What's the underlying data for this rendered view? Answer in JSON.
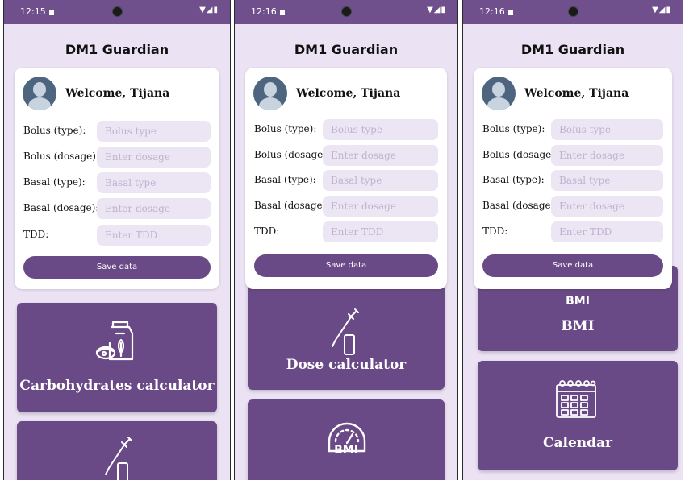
{
  "app_title": "DM1 Guardian",
  "welcome": "Welcome, Tijana",
  "form": {
    "fields": [
      {
        "label": "Bolus (type):",
        "placeholder": "Bolus type"
      },
      {
        "label": "Bolus (dosage):",
        "placeholder": "Enter dosage"
      },
      {
        "label": "Basal (type):",
        "placeholder": "Basal type"
      },
      {
        "label": "Basal (dosage):",
        "placeholder": "Enter dosage"
      },
      {
        "label": "TDD:",
        "placeholder": "Enter TDD"
      }
    ],
    "save_label": "Save data"
  },
  "screens": [
    {
      "time": "12:15",
      "tiles": [
        "Carbohydrates calculator"
      ]
    },
    {
      "time": "12:16",
      "tiles": [
        "Dose calculator"
      ],
      "bmi_icon_text": "BMI"
    },
    {
      "time": "12:16",
      "tiles": [
        "BMI",
        "Calendar"
      ],
      "bmi_partial_text": "BMI"
    }
  ],
  "colors": {
    "accent": "#6a4a86",
    "status_bar": "#6f4f8c",
    "background": "#ebe3f4",
    "field": "#ece6f4"
  },
  "icons": [
    "food-bag-icon",
    "syringe-icon",
    "gauge-icon",
    "calendar-icon",
    "avatar-icon"
  ]
}
